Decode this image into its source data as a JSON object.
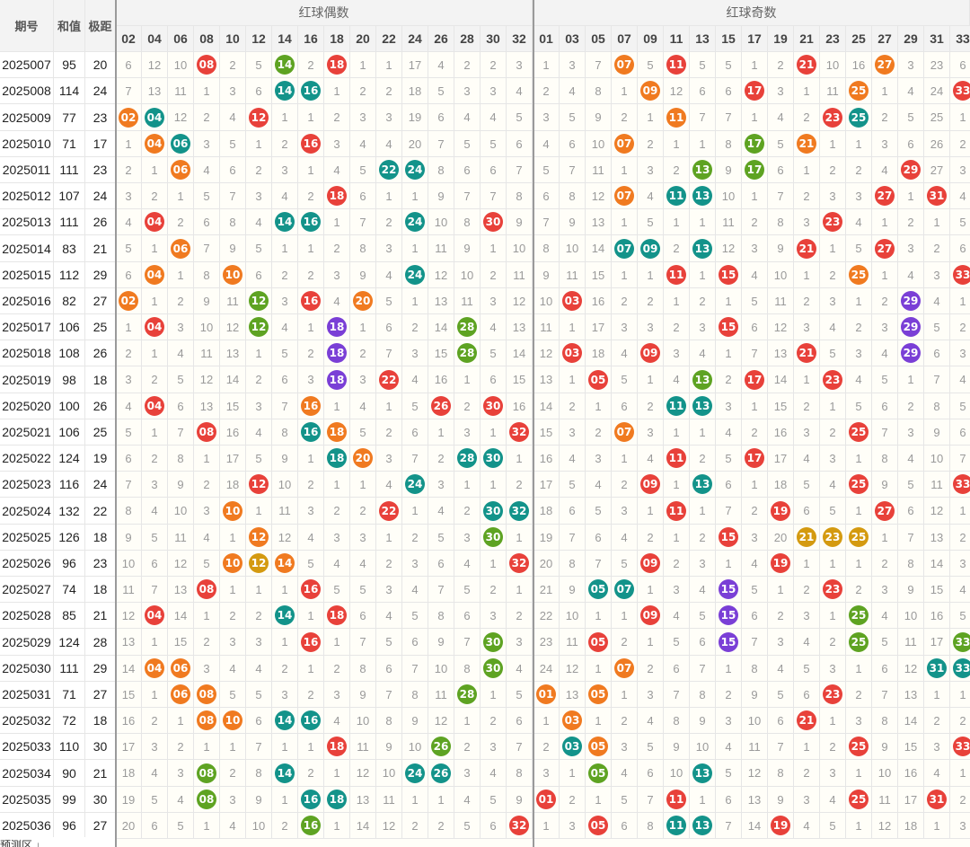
{
  "header": {
    "period_label": "期号",
    "sum_label": "和值",
    "range_label": "极距",
    "even_group_label": "红球偶数",
    "odd_group_label": "红球奇数"
  },
  "even_columns": [
    "02",
    "04",
    "06",
    "08",
    "10",
    "12",
    "14",
    "16",
    "18",
    "20",
    "22",
    "24",
    "26",
    "28",
    "30",
    "32"
  ],
  "odd_columns": [
    "01",
    "03",
    "05",
    "07",
    "09",
    "11",
    "13",
    "15",
    "17",
    "19",
    "21",
    "23",
    "25",
    "27",
    "29",
    "31",
    "33"
  ],
  "colors": {
    "red": "#e8413a",
    "orange": "#f07a20",
    "teal": "#13938a",
    "green": "#5ea322",
    "purple": "#7a3fd6",
    "gold": "#d49a10",
    "shade": "#ecebe4"
  },
  "rows": [
    {
      "period": "2025007",
      "sum": "95",
      "range": "20",
      "even": [
        "6",
        "12",
        "10",
        "08",
        "2",
        "5",
        "14",
        "2",
        "18",
        "1",
        "1",
        "17",
        "4",
        "2",
        "2",
        "3"
      ],
      "odd": [
        "1",
        "3",
        "7",
        "07",
        "5",
        "11",
        "5",
        "5",
        "1",
        "2",
        "21",
        "10",
        "16",
        "27",
        "3",
        "23",
        "6"
      ]
    },
    {
      "period": "2025008",
      "sum": "114",
      "range": "24",
      "even": [
        "7",
        "13",
        "11",
        "1",
        "3",
        "6",
        "14",
        "16",
        "1",
        "2",
        "2",
        "18",
        "5",
        "3",
        "3",
        "4"
      ],
      "odd": [
        "2",
        "4",
        "8",
        "1",
        "09",
        "12",
        "6",
        "6",
        "17",
        "3",
        "1",
        "11",
        "25",
        "1",
        "4",
        "24",
        "33"
      ]
    },
    {
      "period": "2025009",
      "sum": "77",
      "range": "23",
      "even": [
        "02",
        "04",
        "12",
        "2",
        "4",
        "12",
        "1",
        "1",
        "2",
        "3",
        "3",
        "19",
        "6",
        "4",
        "4",
        "5"
      ],
      "odd": [
        "3",
        "5",
        "9",
        "2",
        "1",
        "11",
        "7",
        "7",
        "1",
        "4",
        "2",
        "23",
        "25",
        "2",
        "5",
        "25",
        "1"
      ]
    },
    {
      "period": "2025010",
      "sum": "71",
      "range": "17",
      "even": [
        "1",
        "04",
        "06",
        "3",
        "5",
        "1",
        "2",
        "16",
        "3",
        "4",
        "4",
        "20",
        "7",
        "5",
        "5",
        "6"
      ],
      "odd": [
        "4",
        "6",
        "10",
        "07",
        "2",
        "1",
        "1",
        "8",
        "17",
        "5",
        "21",
        "1",
        "1",
        "3",
        "6",
        "26",
        "2"
      ]
    },
    {
      "period": "2025011",
      "sum": "111",
      "range": "23",
      "even": [
        "2",
        "1",
        "06",
        "4",
        "6",
        "2",
        "3",
        "1",
        "4",
        "5",
        "22",
        "24",
        "8",
        "6",
        "6",
        "7"
      ],
      "odd": [
        "5",
        "7",
        "11",
        "1",
        "3",
        "2",
        "13",
        "9",
        "17",
        "6",
        "1",
        "2",
        "2",
        "4",
        "29",
        "27",
        "3"
      ]
    },
    {
      "period": "2025012",
      "sum": "107",
      "range": "24",
      "even": [
        "3",
        "2",
        "1",
        "5",
        "7",
        "3",
        "4",
        "2",
        "18",
        "6",
        "1",
        "1",
        "9",
        "7",
        "7",
        "8"
      ],
      "odd": [
        "6",
        "8",
        "12",
        "07",
        "4",
        "11",
        "13",
        "10",
        "1",
        "7",
        "2",
        "3",
        "3",
        "27",
        "1",
        "31",
        "4"
      ]
    },
    {
      "period": "2025013",
      "sum": "111",
      "range": "26",
      "even": [
        "4",
        "04",
        "2",
        "6",
        "8",
        "4",
        "14",
        "16",
        "1",
        "7",
        "2",
        "24",
        "10",
        "8",
        "30",
        "9"
      ],
      "odd": [
        "7",
        "9",
        "13",
        "1",
        "5",
        "1",
        "1",
        "11",
        "2",
        "8",
        "3",
        "23",
        "4",
        "1",
        "2",
        "1",
        "5"
      ]
    },
    {
      "period": "2025014",
      "sum": "83",
      "range": "21",
      "even": [
        "5",
        "1",
        "06",
        "7",
        "9",
        "5",
        "1",
        "1",
        "2",
        "8",
        "3",
        "1",
        "11",
        "9",
        "1",
        "10"
      ],
      "odd": [
        "8",
        "10",
        "14",
        "07",
        "09",
        "2",
        "13",
        "12",
        "3",
        "9",
        "21",
        "1",
        "5",
        "27",
        "3",
        "2",
        "6"
      ]
    },
    {
      "period": "2025015",
      "sum": "112",
      "range": "29",
      "even": [
        "6",
        "04",
        "1",
        "8",
        "10",
        "6",
        "2",
        "2",
        "3",
        "9",
        "4",
        "24",
        "12",
        "10",
        "2",
        "11"
      ],
      "odd": [
        "9",
        "11",
        "15",
        "1",
        "1",
        "11",
        "1",
        "15",
        "4",
        "10",
        "1",
        "2",
        "25",
        "1",
        "4",
        "3",
        "33"
      ]
    },
    {
      "period": "2025016",
      "sum": "82",
      "range": "27",
      "even": [
        "02",
        "1",
        "2",
        "9",
        "11",
        "12",
        "3",
        "16",
        "4",
        "20",
        "5",
        "1",
        "13",
        "11",
        "3",
        "12"
      ],
      "odd": [
        "10",
        "03",
        "16",
        "2",
        "2",
        "1",
        "2",
        "1",
        "5",
        "11",
        "2",
        "3",
        "1",
        "2",
        "29",
        "4",
        "1"
      ]
    },
    {
      "period": "2025017",
      "sum": "106",
      "range": "25",
      "even": [
        "1",
        "04",
        "3",
        "10",
        "12",
        "12",
        "4",
        "1",
        "18",
        "1",
        "6",
        "2",
        "14",
        "28",
        "4",
        "13"
      ],
      "odd": [
        "11",
        "1",
        "17",
        "3",
        "3",
        "2",
        "3",
        "15",
        "6",
        "12",
        "3",
        "4",
        "2",
        "3",
        "29",
        "5",
        "2"
      ]
    },
    {
      "period": "2025018",
      "sum": "108",
      "range": "26",
      "even": [
        "2",
        "1",
        "4",
        "11",
        "13",
        "1",
        "5",
        "2",
        "18",
        "2",
        "7",
        "3",
        "15",
        "28",
        "5",
        "14"
      ],
      "odd": [
        "12",
        "03",
        "18",
        "4",
        "09",
        "3",
        "4",
        "1",
        "7",
        "13",
        "21",
        "5",
        "3",
        "4",
        "29",
        "6",
        "3"
      ]
    },
    {
      "period": "2025019",
      "sum": "98",
      "range": "18",
      "even": [
        "3",
        "2",
        "5",
        "12",
        "14",
        "2",
        "6",
        "3",
        "18",
        "3",
        "22",
        "4",
        "16",
        "1",
        "6",
        "15"
      ],
      "odd": [
        "13",
        "1",
        "05",
        "5",
        "1",
        "4",
        "13",
        "2",
        "17",
        "14",
        "1",
        "23",
        "4",
        "5",
        "1",
        "7",
        "4"
      ]
    },
    {
      "period": "2025020",
      "sum": "100",
      "range": "26",
      "even": [
        "4",
        "04",
        "6",
        "13",
        "15",
        "3",
        "7",
        "16",
        "1",
        "4",
        "1",
        "5",
        "26",
        "2",
        "30",
        "16"
      ],
      "odd": [
        "14",
        "2",
        "1",
        "6",
        "2",
        "11",
        "13",
        "3",
        "1",
        "15",
        "2",
        "1",
        "5",
        "6",
        "2",
        "8",
        "5"
      ]
    },
    {
      "period": "2025021",
      "sum": "106",
      "range": "25",
      "even": [
        "5",
        "1",
        "7",
        "08",
        "16",
        "4",
        "8",
        "16",
        "18",
        "5",
        "2",
        "6",
        "1",
        "3",
        "1",
        "32"
      ],
      "odd": [
        "15",
        "3",
        "2",
        "07",
        "3",
        "1",
        "1",
        "4",
        "2",
        "16",
        "3",
        "2",
        "25",
        "7",
        "3",
        "9",
        "6"
      ]
    },
    {
      "period": "2025022",
      "sum": "124",
      "range": "19",
      "even": [
        "6",
        "2",
        "8",
        "1",
        "17",
        "5",
        "9",
        "1",
        "18",
        "20",
        "3",
        "7",
        "2",
        "28",
        "30",
        "1"
      ],
      "odd": [
        "16",
        "4",
        "3",
        "1",
        "4",
        "11",
        "2",
        "5",
        "17",
        "17",
        "4",
        "3",
        "1",
        "8",
        "4",
        "10",
        "7"
      ]
    },
    {
      "period": "2025023",
      "sum": "116",
      "range": "24",
      "even": [
        "7",
        "3",
        "9",
        "2",
        "18",
        "12",
        "10",
        "2",
        "1",
        "1",
        "4",
        "24",
        "3",
        "1",
        "1",
        "2"
      ],
      "odd": [
        "17",
        "5",
        "4",
        "2",
        "09",
        "1",
        "13",
        "6",
        "1",
        "18",
        "5",
        "4",
        "25",
        "9",
        "5",
        "11",
        "33"
      ]
    },
    {
      "period": "2025024",
      "sum": "132",
      "range": "22",
      "even": [
        "8",
        "4",
        "10",
        "3",
        "10",
        "1",
        "11",
        "3",
        "2",
        "2",
        "22",
        "1",
        "4",
        "2",
        "30",
        "32"
      ],
      "odd": [
        "18",
        "6",
        "5",
        "3",
        "1",
        "11",
        "1",
        "7",
        "2",
        "19",
        "6",
        "5",
        "1",
        "27",
        "6",
        "12",
        "1"
      ]
    },
    {
      "period": "2025025",
      "sum": "126",
      "range": "18",
      "even": [
        "9",
        "5",
        "11",
        "4",
        "1",
        "12",
        "12",
        "4",
        "3",
        "3",
        "1",
        "2",
        "5",
        "3",
        "30",
        "1"
      ],
      "odd": [
        "19",
        "7",
        "6",
        "4",
        "2",
        "1",
        "2",
        "15",
        "3",
        "20",
        "21",
        "23",
        "25",
        "1",
        "7",
        "13",
        "2"
      ]
    },
    {
      "period": "2025026",
      "sum": "96",
      "range": "23",
      "even": [
        "10",
        "6",
        "12",
        "5",
        "10",
        "12",
        "14",
        "5",
        "4",
        "4",
        "2",
        "3",
        "6",
        "4",
        "1",
        "32"
      ],
      "odd": [
        "20",
        "8",
        "7",
        "5",
        "09",
        "2",
        "3",
        "1",
        "4",
        "19",
        "1",
        "1",
        "1",
        "2",
        "8",
        "14",
        "3"
      ]
    },
    {
      "period": "2025027",
      "sum": "74",
      "range": "18",
      "even": [
        "11",
        "7",
        "13",
        "08",
        "1",
        "1",
        "1",
        "16",
        "5",
        "5",
        "3",
        "4",
        "7",
        "5",
        "2",
        "1"
      ],
      "odd": [
        "21",
        "9",
        "05",
        "07",
        "1",
        "3",
        "4",
        "15",
        "5",
        "1",
        "2",
        "23",
        "2",
        "3",
        "9",
        "15",
        "4"
      ]
    },
    {
      "period": "2025028",
      "sum": "85",
      "range": "21",
      "even": [
        "12",
        "04",
        "14",
        "1",
        "2",
        "2",
        "14",
        "1",
        "18",
        "6",
        "4",
        "5",
        "8",
        "6",
        "3",
        "2"
      ],
      "odd": [
        "22",
        "10",
        "1",
        "1",
        "09",
        "4",
        "5",
        "15",
        "6",
        "2",
        "3",
        "1",
        "25",
        "4",
        "10",
        "16",
        "5"
      ]
    },
    {
      "period": "2025029",
      "sum": "124",
      "range": "28",
      "even": [
        "13",
        "1",
        "15",
        "2",
        "3",
        "3",
        "1",
        "16",
        "1",
        "7",
        "5",
        "6",
        "9",
        "7",
        "30",
        "3"
      ],
      "odd": [
        "23",
        "11",
        "05",
        "2",
        "1",
        "5",
        "6",
        "15",
        "7",
        "3",
        "4",
        "2",
        "25",
        "5",
        "11",
        "17",
        "33"
      ]
    },
    {
      "period": "2025030",
      "sum": "111",
      "range": "29",
      "even": [
        "14",
        "04",
        "06",
        "3",
        "4",
        "4",
        "2",
        "1",
        "2",
        "8",
        "6",
        "7",
        "10",
        "8",
        "30",
        "4"
      ],
      "odd": [
        "24",
        "12",
        "1",
        "07",
        "2",
        "6",
        "7",
        "1",
        "8",
        "4",
        "5",
        "3",
        "1",
        "6",
        "12",
        "31",
        "33"
      ]
    },
    {
      "period": "2025031",
      "sum": "71",
      "range": "27",
      "even": [
        "15",
        "1",
        "06",
        "08",
        "5",
        "5",
        "3",
        "2",
        "3",
        "9",
        "7",
        "8",
        "11",
        "28",
        "1",
        "5"
      ],
      "odd": [
        "01",
        "13",
        "05",
        "1",
        "3",
        "7",
        "8",
        "2",
        "9",
        "5",
        "6",
        "23",
        "2",
        "7",
        "13",
        "1",
        "1"
      ]
    },
    {
      "period": "2025032",
      "sum": "72",
      "range": "18",
      "even": [
        "16",
        "2",
        "1",
        "08",
        "10",
        "6",
        "14",
        "16",
        "4",
        "10",
        "8",
        "9",
        "12",
        "1",
        "2",
        "6"
      ],
      "odd": [
        "1",
        "03",
        "1",
        "2",
        "4",
        "8",
        "9",
        "3",
        "10",
        "6",
        "21",
        "1",
        "3",
        "8",
        "14",
        "2",
        "2"
      ]
    },
    {
      "period": "2025033",
      "sum": "110",
      "range": "30",
      "even": [
        "17",
        "3",
        "2",
        "1",
        "1",
        "7",
        "1",
        "1",
        "18",
        "11",
        "9",
        "10",
        "26",
        "2",
        "3",
        "7"
      ],
      "odd": [
        "2",
        "03",
        "05",
        "3",
        "5",
        "9",
        "10",
        "4",
        "11",
        "7",
        "1",
        "2",
        "25",
        "9",
        "15",
        "3",
        "33"
      ]
    },
    {
      "period": "2025034",
      "sum": "90",
      "range": "21",
      "even": [
        "18",
        "4",
        "3",
        "08",
        "2",
        "8",
        "14",
        "2",
        "1",
        "12",
        "10",
        "24",
        "26",
        "3",
        "4",
        "8"
      ],
      "odd": [
        "3",
        "1",
        "05",
        "4",
        "6",
        "10",
        "13",
        "5",
        "12",
        "8",
        "2",
        "3",
        "1",
        "10",
        "16",
        "4",
        "1"
      ]
    },
    {
      "period": "2025035",
      "sum": "99",
      "range": "30",
      "even": [
        "19",
        "5",
        "4",
        "08",
        "3",
        "9",
        "1",
        "16",
        "18",
        "13",
        "11",
        "1",
        "1",
        "4",
        "5",
        "9"
      ],
      "odd": [
        "01",
        "2",
        "1",
        "5",
        "7",
        "11",
        "1",
        "6",
        "13",
        "9",
        "3",
        "4",
        "25",
        "11",
        "17",
        "31",
        "2"
      ]
    },
    {
      "period": "2025036",
      "sum": "96",
      "range": "27",
      "even": [
        "20",
        "6",
        "5",
        "1",
        "4",
        "10",
        "2",
        "16",
        "1",
        "14",
        "12",
        "2",
        "2",
        "5",
        "6",
        "32"
      ],
      "odd": [
        "1",
        "3",
        "05",
        "6",
        "8",
        "11",
        "13",
        "7",
        "14",
        "19",
        "4",
        "5",
        "1",
        "12",
        "18",
        "1",
        "3"
      ]
    }
  ],
  "footer": {
    "prediction_label": "预测区 ↓"
  }
}
